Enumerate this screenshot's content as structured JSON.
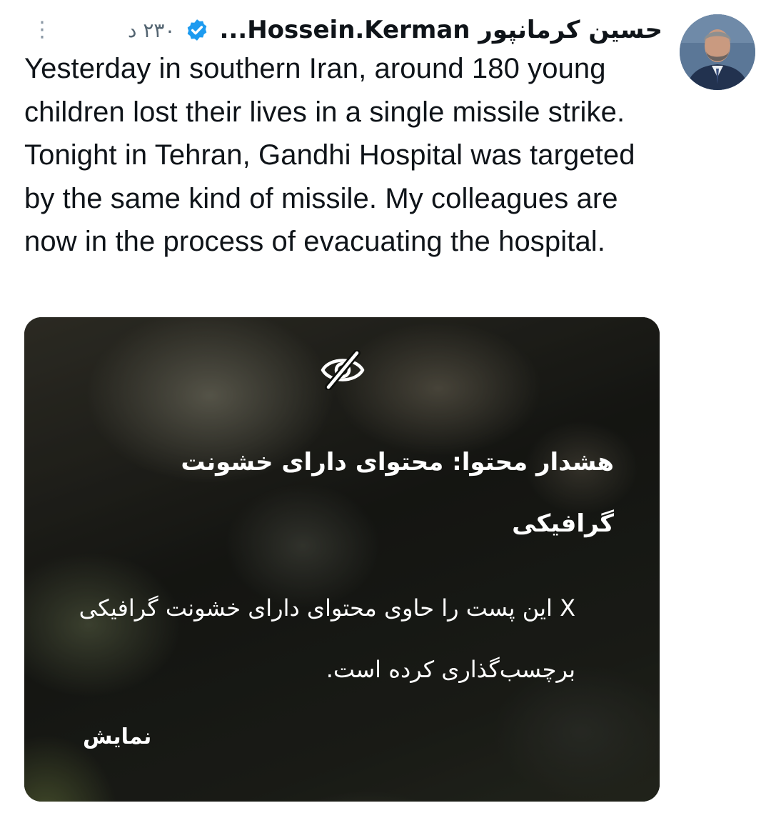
{
  "author": {
    "display_name": "حسین کرمانپور Hossein.Kerman...",
    "avatar_icon": "user-avatar",
    "verified_icon": "verified-badge-icon",
    "verified_color": "#1d9bf0"
  },
  "post": {
    "timestamp": "۲۳۰ د",
    "more_icon": "more-options-icon",
    "text": "Yesterday in southern Iran, around 180 young children lost their lives in a single missile strike. Tonight in Tehran, Gandhi Hospital was targeted by the same kind of missile. My colleagues are now in the process of evacuating the hospital."
  },
  "sensitive_media": {
    "icon": "eye-slash-icon",
    "warning_title": "هشدار محتوا: محتوای دارای خشونت گرافیکی",
    "warning_body": "X این پست را حاوی محتوای دارای خشونت گرافیکی برچسب‌گذاری کرده است.",
    "show_label": "نمایش"
  }
}
